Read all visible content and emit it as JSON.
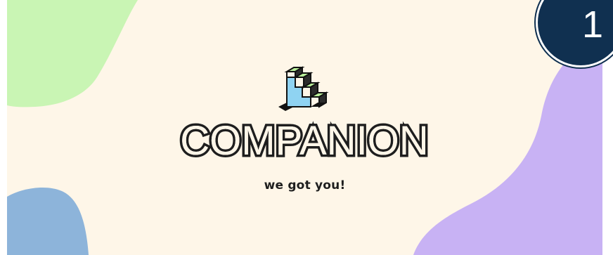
{
  "banner": {
    "wordmark": "COMPANION",
    "tagline": "we got you!",
    "logo_icon": "stairs-icon"
  },
  "step_badge": {
    "number": "1"
  },
  "colors": {
    "background": "#fef6e8",
    "blob_green": "#c9f5b4",
    "blob_blue": "#8db4da",
    "blob_purple": "#c8b2f4",
    "badge": "#103050",
    "ink": "#1e1e1e"
  }
}
